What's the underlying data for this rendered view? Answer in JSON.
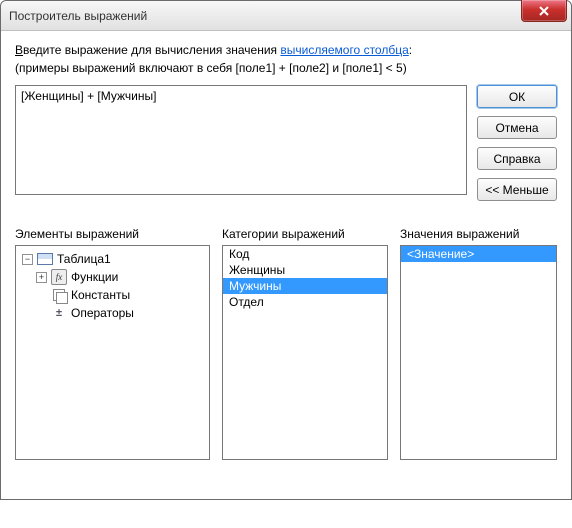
{
  "title": "Построитель выражений",
  "prompt_pre": "Введите выражение для вычисления значения ",
  "prompt_ul_char": "В",
  "prompt_link": "вычисляемого столбца",
  "prompt_post": ":",
  "hint": "(примеры выражений включают в себя [поле1] + [поле2] и [поле1] < 5)",
  "expression": "[Женщины] + [Мужчины]",
  "buttons": {
    "ok": "ОК",
    "cancel": "Отмена",
    "help": "Справка",
    "less": "<< Меньше"
  },
  "panes": {
    "elements_label": "Элементы выражений",
    "categories_label": "Категории выражений",
    "values_label": "Значения выражений",
    "elements": [
      {
        "label": "Таблица1",
        "expander": "minus",
        "icon": "table"
      },
      {
        "label": "Функции",
        "expander": "plus",
        "icon": "fx"
      },
      {
        "label": "Константы",
        "expander": "none",
        "icon": "const"
      },
      {
        "label": "Операторы",
        "expander": "none",
        "icon": "op"
      }
    ],
    "categories": [
      {
        "label": "Код",
        "selected": false
      },
      {
        "label": "Женщины",
        "selected": false
      },
      {
        "label": "Мужчины",
        "selected": true
      },
      {
        "label": "Отдел",
        "selected": false
      }
    ],
    "values": [
      {
        "label": "<Значение>",
        "selected": true
      }
    ]
  }
}
